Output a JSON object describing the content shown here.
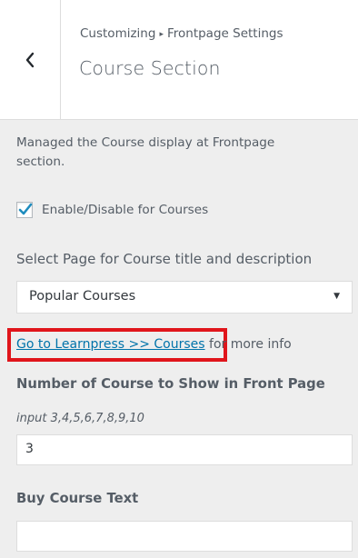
{
  "header": {
    "breadcrumb_root": "Customizing",
    "breadcrumb_separator": "▸",
    "breadcrumb_section": "Frontpage Settings",
    "title": "Course Section"
  },
  "description": "Managed the Course display at Frontpage section.",
  "enable_checkbox": {
    "label": "Enable/Disable for Courses",
    "checked": true
  },
  "page_select": {
    "title": "Select Page for Course title and description",
    "value": "Popular Courses"
  },
  "learnpress_link": {
    "link_text": "Go to Learnpress >> Courses",
    "suffix": "for more info"
  },
  "course_count": {
    "title": "Number of Course to Show in Front Page",
    "hint": "input 3,4,5,6,7,8,9,10",
    "value": "3"
  },
  "buy_course_text": {
    "title": "Buy Course Text",
    "value": ""
  },
  "colors": {
    "link": "#0073aa",
    "highlight_border": "#e0151b",
    "checkmark": "#1e8cbe"
  }
}
